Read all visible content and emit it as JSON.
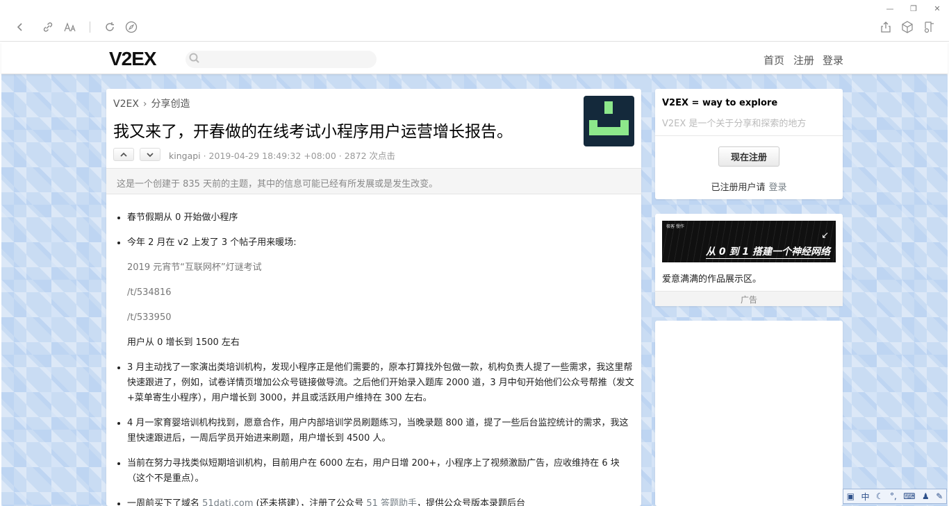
{
  "browser": {
    "window_controls": [
      "—",
      "❐",
      "✕"
    ]
  },
  "site": {
    "logo": "V2EX",
    "search": {
      "placeholder": ""
    },
    "nav": {
      "home": "首页",
      "register": "注册",
      "login": "登录"
    }
  },
  "topic": {
    "breadcrumb": {
      "site": "V2EX",
      "separator": "›",
      "node": "分享创造"
    },
    "title": "我又来了，开春做的在线考试小程序用户运营增长报告。",
    "author": "kingapi",
    "meta_rest": " · 2019-04-29 18:49:32 +08:00 · 2872 次点击",
    "notice": "这是一个创建于 835 天前的主题，其中的信息可能已经有所发展或是发生改变。",
    "content": {
      "item1": "春节假期从 0 开始做小程序",
      "item2": "今年 2 月在 v2 上发了 3 个帖子用来暖场:",
      "item2_sub1": "2019 元宵节“互联网杯”灯谜考试",
      "item2_sub2": "/t/534816",
      "item2_sub3": "/t/533950",
      "item2_sub4": "用户从 0 增长到 1500 左右",
      "item3": "3 月主动找了一家演出类培训机构，发现小程序正是他们需要的，原本打算找外包做一款，机构负责人提了一些需求，我这里帮快速跟进了，例如，试卷详情页增加公众号链接做导流。之后他们开始录入题库 2000 道，3 月中旬开始他们公众号帮推（发文+菜单寄生小程序），用户增长到 3000，并且或活跃用户维持在 300 左右。",
      "item4": "4 月一家育婴培训机构找到，愿意合作，用户内部培训学员刷题练习，当晚录题 800 道，提了一些后台监控统计的需求，我这里快速跟进后，一周后学员开始进来刷题，用户增长到 4500 人。",
      "item5": "当前在努力寻找类似短期培训机构，目前用户在 6000 左右，用户日增 200+，小程序上了视频激励广告，应收维持在 6 块（这个不是重点）。",
      "item6_a": "一周前买下了域名 ",
      "item6_link1": "51dati.com",
      "item6_b": " (还未搭建），注册了公众号 ",
      "item6_link2": "51 答题助手",
      "item6_c": "，提供公众号版本录题后台"
    }
  },
  "sidebar": {
    "slogan": "V2EX = way to explore",
    "description": "V2EX 是一个关于分享和探索的地方",
    "register_button": "现在注册",
    "registered_hint": "已注册用户请",
    "login_link": "登录",
    "ad": {
      "brand": "极客 慢作",
      "banner_text": "从 0 到 1 搭建一个神经网络",
      "caption": "爱意满满的作品展示区。",
      "label": "广告"
    }
  },
  "ime": {
    "mode": "中"
  }
}
